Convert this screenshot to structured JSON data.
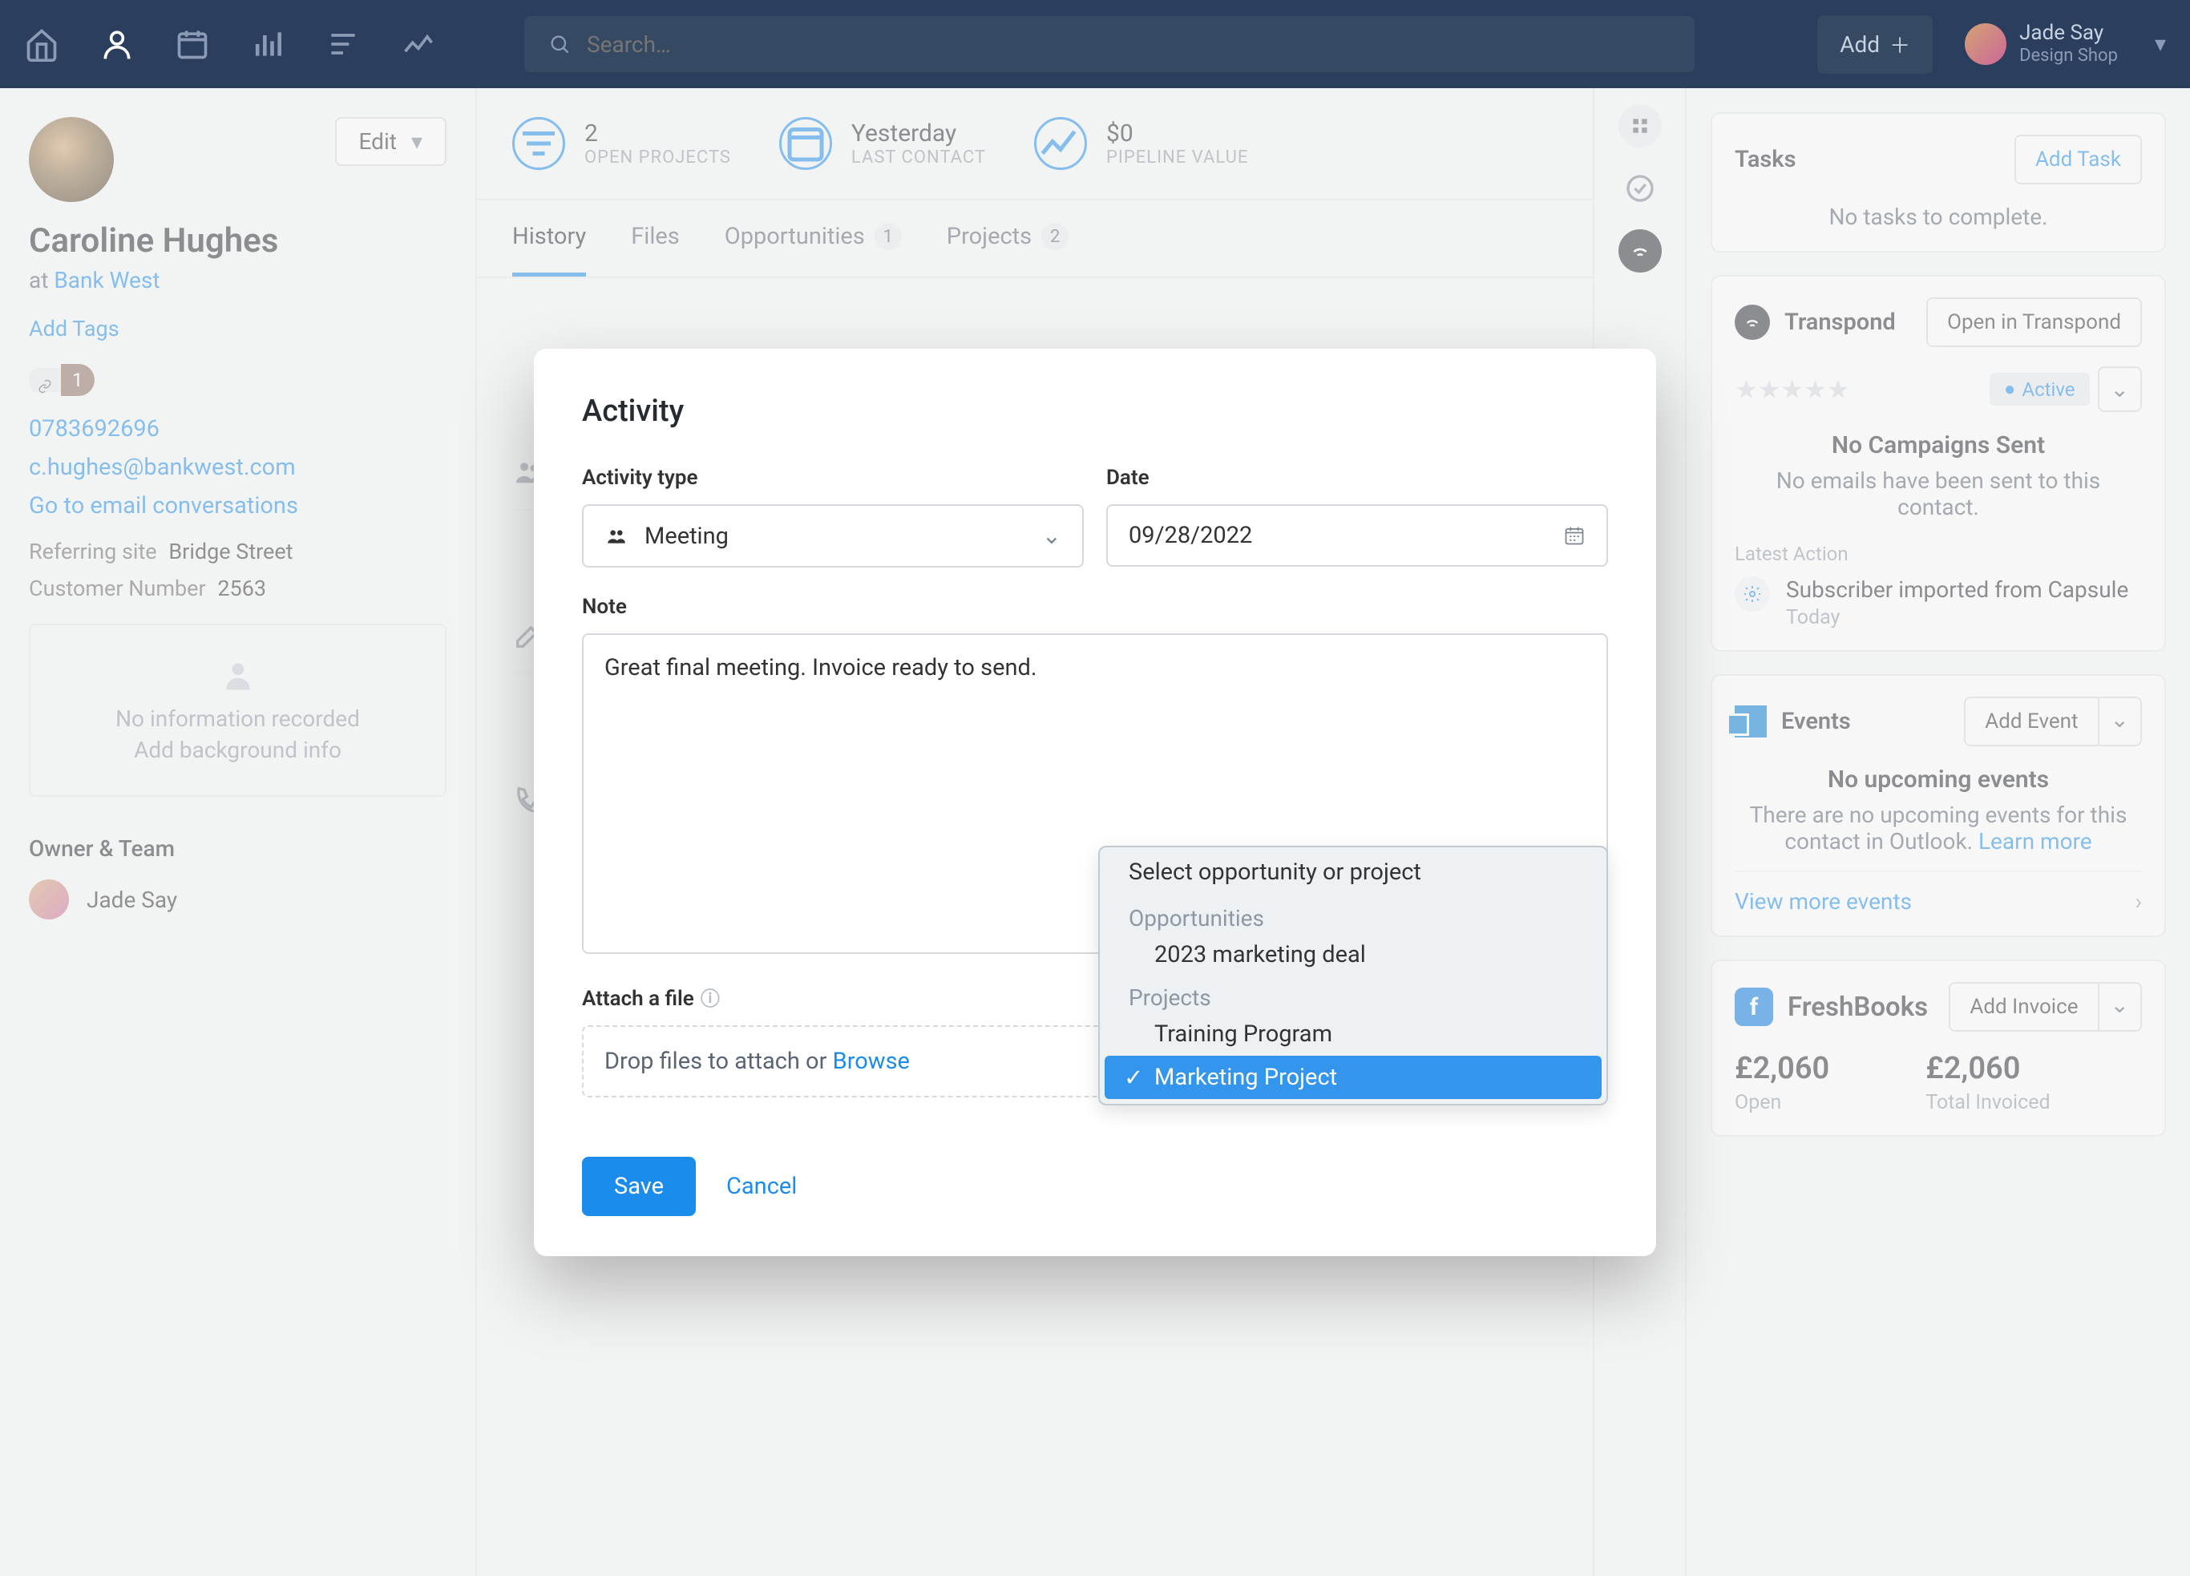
{
  "topnav": {
    "search_placeholder": "Search…",
    "add_label": "Add",
    "user_name": "Jade Say",
    "user_company": "Design Shop"
  },
  "contact": {
    "name": "Caroline Hughes",
    "at_label": "at",
    "company": "Bank West",
    "add_tags": "Add Tags",
    "attachments_count": "1",
    "phone": "0783692696",
    "email": "c.hughes@bankwest.com",
    "convo_link": "Go to email conversations",
    "referring_label": "Referring site",
    "referring_value": "Bridge Street",
    "custnum_label": "Customer Number",
    "custnum_value": "2563",
    "no_info": "No information recorded",
    "add_bg": "Add background info",
    "owner_section": "Owner & Team",
    "owner_name": "Jade Say",
    "edit_label": "Edit"
  },
  "stats": {
    "s1_val": "2",
    "s1_lbl": "OPEN PROJECTS",
    "s2_val": "Yesterday",
    "s2_lbl": "LAST CONTACT",
    "s3_val": "$0",
    "s3_lbl": "PIPELINE VALUE"
  },
  "tabs": {
    "history": "History",
    "files": "Files",
    "opportunities": "Opportunities",
    "opp_count": "1",
    "projects": "Projects",
    "proj_count": "2"
  },
  "right": {
    "tasks_title": "Tasks",
    "add_task": "Add Task",
    "no_tasks": "No tasks to complete.",
    "transpond_title": "Transpond",
    "open_transpond": "Open in Transpond",
    "active_badge": "Active",
    "no_campaigns_h": "No Campaigns Sent",
    "no_campaigns_b": "No emails have been sent to this contact.",
    "latest_action_lbl": "Latest Action",
    "latest_title": "Subscriber imported from Capsule",
    "latest_time": "Today",
    "events_title": "Events",
    "add_event": "Add Event",
    "no_events_h": "No upcoming events",
    "no_events_b1": "There are no upcoming events for this contact in Outlook.",
    "learn_more": "Learn more",
    "view_more_events": "View more events",
    "freshbooks_title": "FreshBooks",
    "add_invoice": "Add Invoice",
    "open_val": "£2,060",
    "open_lbl": "Open",
    "total_val": "£2,060",
    "total_lbl": "Total Invoiced"
  },
  "modal": {
    "title": "Activity",
    "type_label": "Activity type",
    "type_value": "Meeting",
    "date_label": "Date",
    "date_value": "09/28/2022",
    "note_label": "Note",
    "note_value": "Great final meeting. Invoice ready to send.",
    "attach_label": "Attach a file",
    "drop_text": "Drop files to attach or ",
    "browse": "Browse",
    "save": "Save",
    "cancel": "Cancel"
  },
  "dropdown": {
    "header": "Select opportunity or project",
    "group1": "Opportunities",
    "opt1": "2023 marketing deal",
    "group2": "Projects",
    "opt2": "Training Program",
    "opt3": "Marketing Project"
  }
}
